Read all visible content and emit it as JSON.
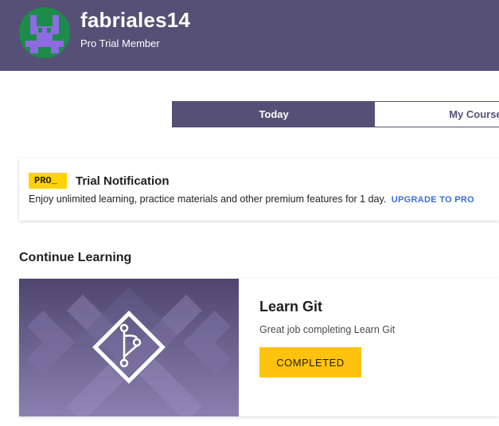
{
  "header": {
    "username": "fabriales14",
    "membership": "Pro Trial Member"
  },
  "tabs": [
    {
      "label": "Today",
      "active": true
    },
    {
      "label": "My Courses",
      "active": false
    }
  ],
  "trial": {
    "badge": "PRO_",
    "title": "Trial Notification",
    "description": "Enjoy unlimited learning, practice materials and other premium features for 1 day.",
    "upgrade_label": "UPGRADE TO PRO"
  },
  "continue_learning": {
    "title": "Continue Learning",
    "course": {
      "title": "Learn Git",
      "subtitle": "Great job completing Learn Git",
      "button_label": "COMPLETED",
      "icon": "git-branch-icon"
    }
  },
  "colors": {
    "header_bg": "#565076",
    "avatar_bg": "#1c8c4a",
    "avatar_fg": "#8e6be0",
    "badge_yellow": "#ffd300",
    "button_yellow": "#ffc20e",
    "link_blue": "#3a6fd6"
  }
}
